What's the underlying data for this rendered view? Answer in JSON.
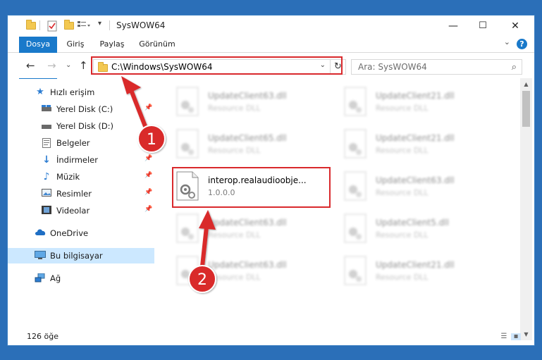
{
  "window": {
    "title": "SysWOW64",
    "controls": {
      "minimize": "—",
      "maximize": "☐",
      "close": "✕"
    }
  },
  "ribbon": {
    "tabs": [
      "Dosya",
      "Giriş",
      "Paylaş",
      "Görünüm"
    ],
    "help": "?"
  },
  "nav": {
    "back_icon": "back-arrow-icon",
    "forward_icon": "forward-arrow-icon",
    "recent_icon": "chevron-down-icon",
    "up_icon": "up-arrow-icon",
    "address": "C:\\Windows\\SysWOW64",
    "search_placeholder": "Ara: SysWOW64"
  },
  "sidebar": {
    "items": [
      {
        "label": "Hızlı erişim",
        "icon": "star-icon",
        "pinned": false
      },
      {
        "label": "Yerel Disk (C:)",
        "icon": "drive-icon",
        "pinned": true
      },
      {
        "label": "Yerel Disk (D:)",
        "icon": "drive-icon",
        "pinned": false
      },
      {
        "label": "Belgeler",
        "icon": "document-icon",
        "pinned": true
      },
      {
        "label": "İndirmeler",
        "icon": "download-icon",
        "pinned": true
      },
      {
        "label": "Müzik",
        "icon": "music-icon",
        "pinned": true
      },
      {
        "label": "Resimler",
        "icon": "pictures-icon",
        "pinned": true
      },
      {
        "label": "Videolar",
        "icon": "video-icon",
        "pinned": true
      },
      {
        "label": "OneDrive",
        "icon": "cloud-icon",
        "pinned": false
      },
      {
        "label": "Bu bilgisayar",
        "icon": "computer-icon",
        "pinned": false,
        "selected": true
      },
      {
        "label": "Ağ",
        "icon": "network-icon",
        "pinned": false
      }
    ]
  },
  "files": [
    {
      "name": "UpdateClient63.dll",
      "desc": "Resource DLL",
      "blurred": true
    },
    {
      "name": "UpdateClient21.dll",
      "desc": "Resource DLL",
      "blurred": true
    },
    {
      "name": "UpdateClient65.dll",
      "desc": "Resource DLL",
      "blurred": true
    },
    {
      "name": "UpdateClient21.dll",
      "desc": "Resource DLL",
      "blurred": true
    },
    {
      "name": "interop.realaudioobje...",
      "desc": "1.0.0.0",
      "blurred": false
    },
    {
      "name": "UpdateClient63.dll",
      "desc": "Resource DLL",
      "blurred": true
    },
    {
      "name": "UpdateClient63.dll",
      "desc": "Resource DLL",
      "blurred": true
    },
    {
      "name": "UpdateClient5.dll",
      "desc": "Resource DLL",
      "blurred": true
    },
    {
      "name": "UpdateClient63.dll",
      "desc": "Resource DLL",
      "blurred": true
    },
    {
      "name": "UpdateClient21.dll",
      "desc": "Resource DLL",
      "blurred": true
    }
  ],
  "status": {
    "count": "126 öğe"
  },
  "annotations": {
    "badge1": "1",
    "badge2": "2",
    "color": "#d9292c"
  }
}
